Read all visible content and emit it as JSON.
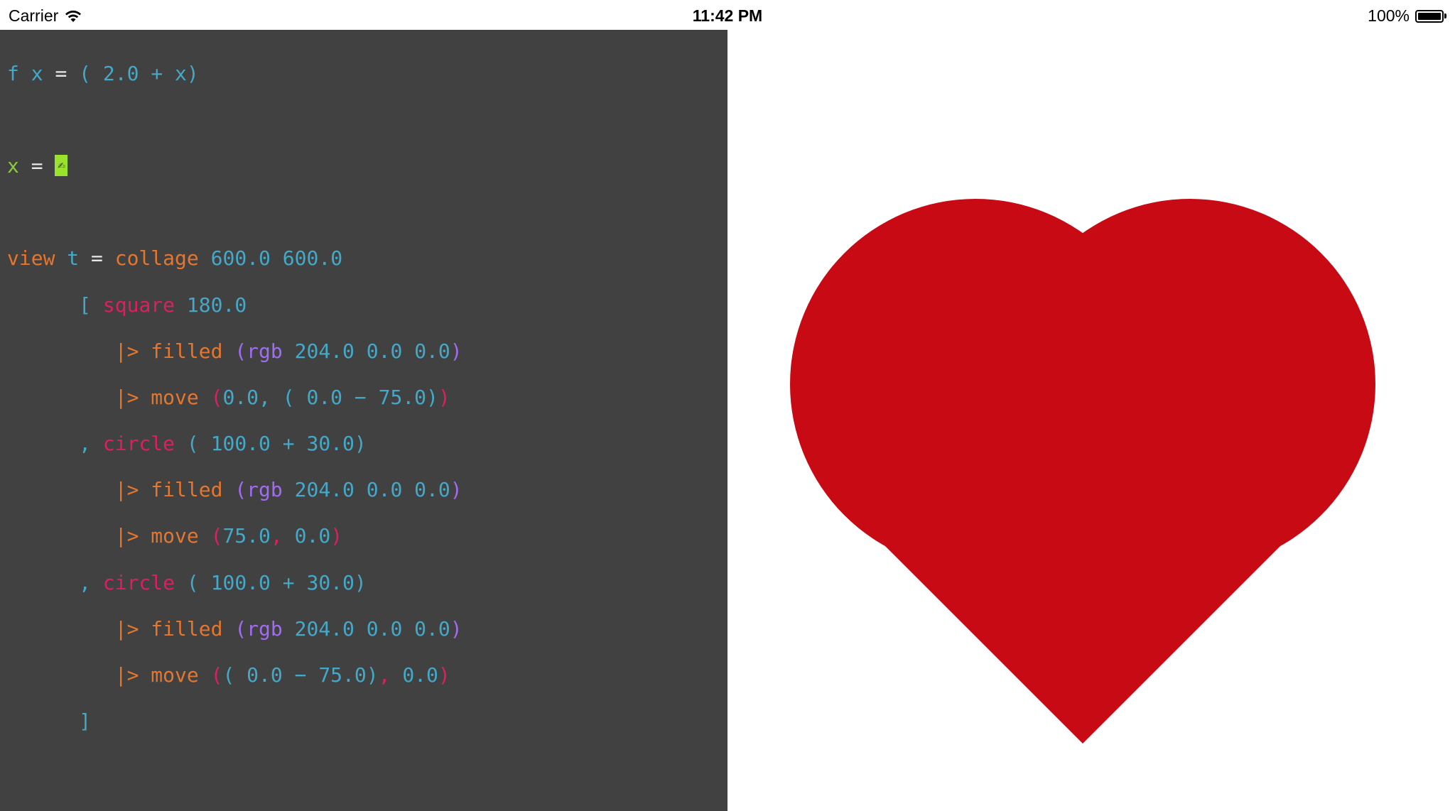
{
  "status_bar": {
    "carrier": "Carrier",
    "time": "11:42 PM",
    "battery": "100%",
    "battery_level": 1.0
  },
  "editor": {
    "line1": {
      "f": "f",
      "x": "x",
      "eq": "=",
      "open": "(",
      "num": "2.0",
      "plus": "+",
      "x2": "x",
      "close": ")"
    },
    "line2": {
      "x": "x",
      "eq": "=",
      "token": "✍"
    },
    "line3": {
      "view": "view",
      "t": "t",
      "eq": "=",
      "collage": "collage",
      "w": "600.0",
      "h": "600.0"
    },
    "line4": {
      "bracket": "[",
      "square": "square",
      "size": "180.0"
    },
    "line5": {
      "pipe": "|>",
      "filled": "filled",
      "open": "(",
      "rgb": "rgb",
      "r": "204.0",
      "g": "0.0",
      "b": "0.0",
      "close": ")"
    },
    "line6": {
      "pipe": "|>",
      "move": "move",
      "open": "(",
      "x": "0.0,",
      "o2": "(",
      "y": "0.0 − 75.0)",
      "close": ")"
    },
    "line7": {
      "comma": ",",
      "circle": "circle",
      "args": "( 100.0 + 30.0)"
    },
    "line8": {
      "pipe": "|>",
      "filled": "filled",
      "open": "(",
      "rgb": "rgb",
      "vals": "204.0 0.0 0.0",
      "close": ")"
    },
    "line9": {
      "pipe": "|>",
      "move": "move",
      "open": "(",
      "x": "75.0",
      "sep": ",",
      "y": "0.0",
      "close": ")"
    },
    "line10": {
      "comma": ",",
      "circle": "circle",
      "args": "( 100.0 + 30.0)"
    },
    "line11": {
      "pipe": "|>",
      "filled": "filled",
      "open": "(",
      "rgb": "rgb",
      "vals": "204.0 0.0 0.0",
      "close": ")"
    },
    "line12": {
      "pipe": "|>",
      "move": "move",
      "open": "(",
      "x": "( 0.0 − 75.0)",
      "sep": ",",
      "y": "0.0",
      "close": ")"
    },
    "line13": {
      "bracket": "]"
    }
  },
  "preview": {
    "shape": "heart",
    "fill_color": "#c80a14"
  },
  "colors": {
    "editor_bg": "#414141",
    "keyword_orange": "#e5762e",
    "number_blue": "#44a8c9",
    "identifier_green": "#8ccb3a",
    "function_pink": "#dc1f62",
    "builtin_purple": "#a06cf0",
    "heart_red": "#c80a14"
  }
}
